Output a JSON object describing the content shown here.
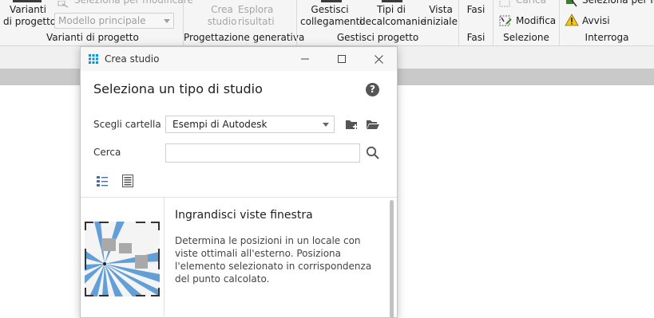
{
  "ribbon": {
    "varianti": {
      "line1": "Varianti",
      "line2": "di progetto"
    },
    "seleziona_modificare": "Seleziona per modificare",
    "modello_principale": "Modello principale",
    "crea_studio": {
      "line1": "Crea",
      "line2": "studio"
    },
    "esplora_risultati": {
      "line1": "Esplora",
      "line2": "risultati"
    },
    "gestisci_collegamenti": {
      "line1": "Gestisci",
      "line2": "collegamenti"
    },
    "tipi_decalcomanie": {
      "line1": "Tipi di",
      "line2": "decalcomanie"
    },
    "vista_iniziale": {
      "line1": "Vista",
      "line2": "iniziale"
    },
    "fasi": "Fasi",
    "carica": "Carica",
    "modifica": "Modifica",
    "seleziona_per_id": "Seleziona per ID",
    "avvisi": "Avvisi",
    "groups": {
      "varianti": "Varianti di progetto",
      "progettazione": "Progettazione generativa",
      "gestisci": "Gestisci progetto",
      "fasi": "Fasi",
      "selezione": "Selezione",
      "interroga": "Interroga"
    }
  },
  "dialog": {
    "title": "Crea studio",
    "heading": "Seleziona un tipo di studio",
    "folder_label": "Scegli cartella",
    "folder_value": "Esempi di Autodesk",
    "search_label": "Cerca",
    "search_value": "",
    "item": {
      "title": "Ingrandisci viste finestra",
      "description": "Determina le posizioni in un locale con viste ottimali all'esterno. Posiziona l'elemento selezionato in corrispondenza del punto calcolato."
    }
  },
  "colors": {
    "accent": "#0696d7",
    "thumb_blue": "#4a90d9",
    "thumb_gray": "#a9a9a9"
  }
}
